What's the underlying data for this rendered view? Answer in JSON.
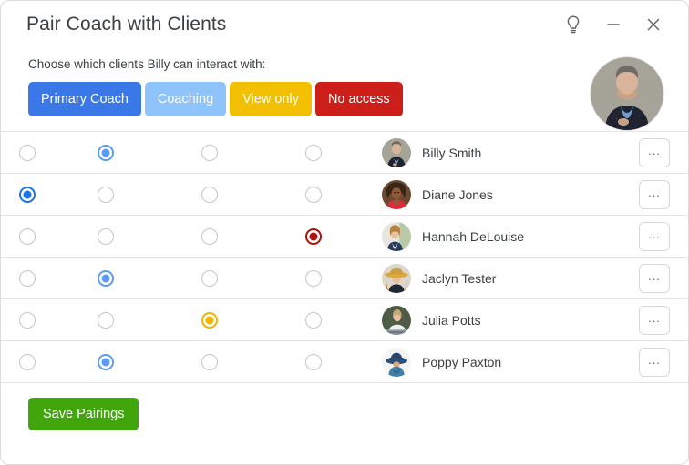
{
  "window": {
    "title": "Pair Coach with Clients",
    "titlebar_icons": [
      {
        "name": "lightbulb-icon",
        "glyph": "lightbulb"
      },
      {
        "name": "minimize-icon",
        "glyph": "minimize"
      },
      {
        "name": "close-icon",
        "glyph": "close"
      }
    ]
  },
  "header": {
    "subtitle": "Choose which clients Billy can interact with:",
    "coach_avatar_alt": "Billy Smith coach photo"
  },
  "legend": [
    {
      "label": "Primary Coach",
      "color": "#3b78e7",
      "text_color": "#ffffff"
    },
    {
      "label": "Coaching",
      "color": "#8ec3fb",
      "text_color": "#ffffff"
    },
    {
      "label": "View only",
      "color": "#f2c000",
      "text_color": "#ffffff"
    },
    {
      "label": "No access",
      "color": "#cc1f1a",
      "text_color": "#ffffff"
    }
  ],
  "columns": [
    {
      "key": "primary",
      "label": "Primary Coach",
      "color": "#1a73e8"
    },
    {
      "key": "coaching",
      "label": "Coaching",
      "color": "#5b9bf8"
    },
    {
      "key": "view",
      "label": "View only",
      "color": "#f2b400"
    },
    {
      "key": "none",
      "label": "No access",
      "color": "#b3120c"
    }
  ],
  "rows": [
    {
      "name": "Billy Smith",
      "selected": 1,
      "more_label": "...",
      "avatar": "man-suit-photo"
    },
    {
      "name": "Diane Jones",
      "selected": 0,
      "more_label": "...",
      "avatar": "woman-red-photo"
    },
    {
      "name": "Hannah DeLouise",
      "selected": 3,
      "more_label": "...",
      "avatar": "woman-blazer-photo"
    },
    {
      "name": "Jaclyn Tester",
      "selected": 1,
      "more_label": "...",
      "avatar": "woman-hat-photo"
    },
    {
      "name": "Julia Potts",
      "selected": 2,
      "more_label": "...",
      "avatar": "woman-desk-photo"
    },
    {
      "name": "Poppy Paxton",
      "selected": 1,
      "more_label": "...",
      "avatar": "woman-bluehat-photo"
    }
  ],
  "footer": {
    "save_label": "Save Pairings",
    "save_color": "#41a50c"
  }
}
